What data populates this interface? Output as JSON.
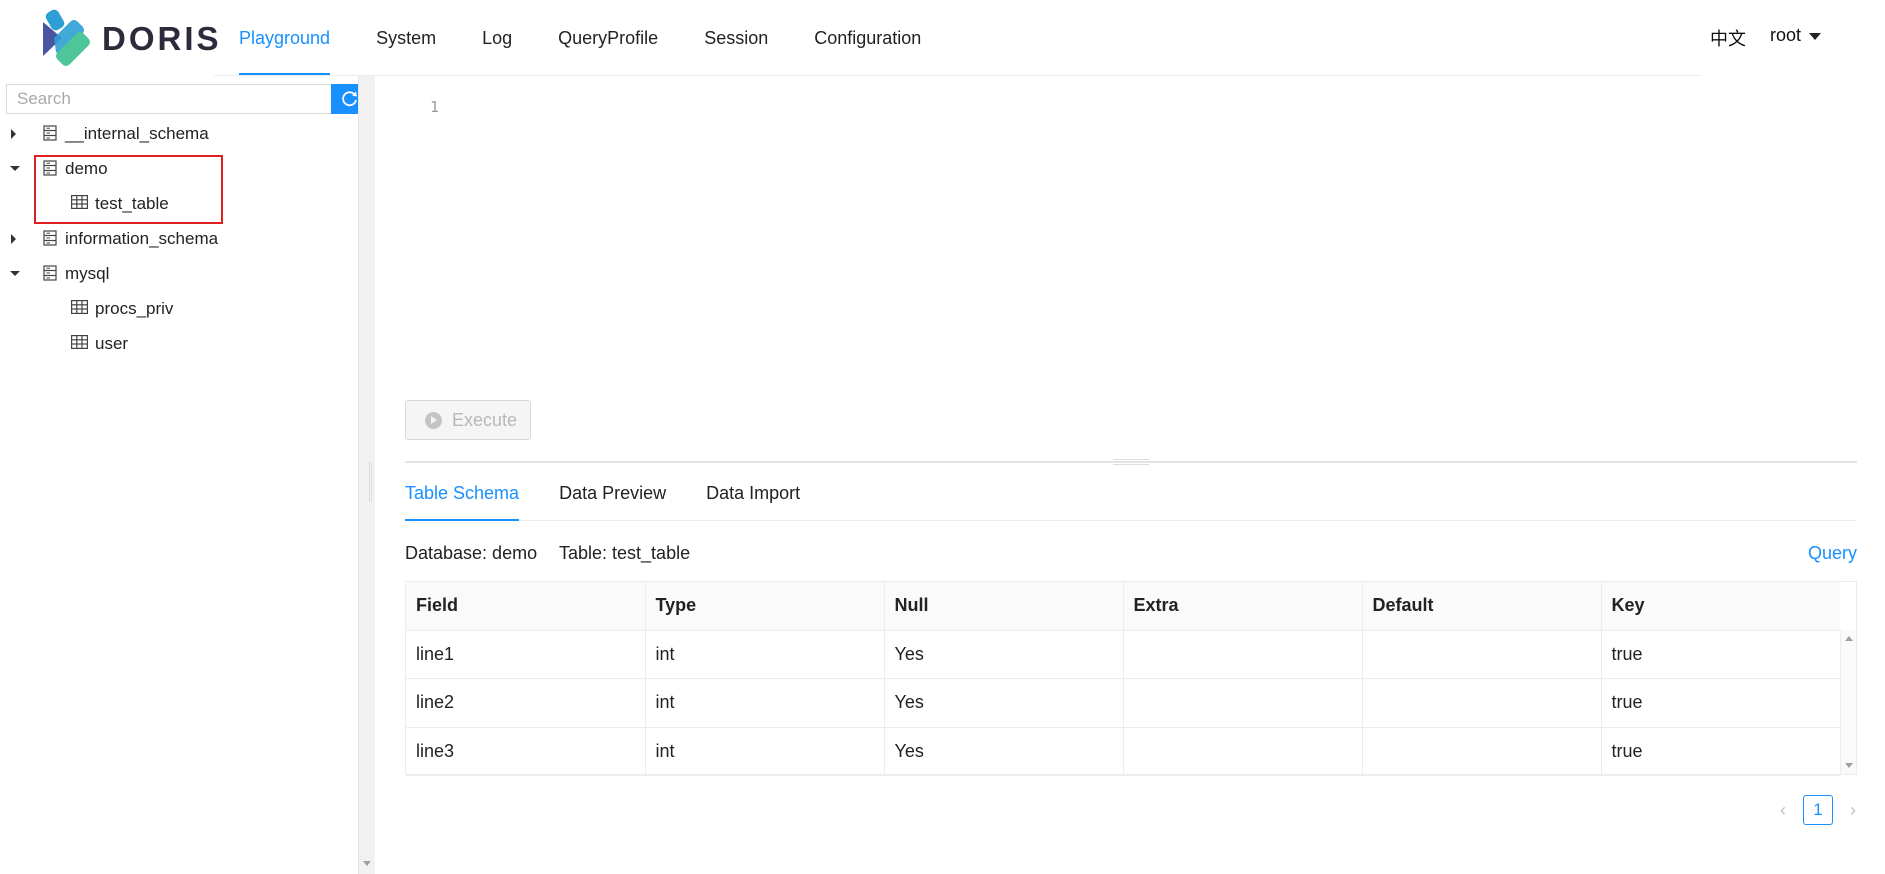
{
  "header": {
    "logo_text": "DORIS",
    "nav": [
      {
        "label": "Playground",
        "active": true
      },
      {
        "label": "System",
        "active": false
      },
      {
        "label": "Log",
        "active": false
      },
      {
        "label": "QueryProfile",
        "active": false
      },
      {
        "label": "Session",
        "active": false
      },
      {
        "label": "Configuration",
        "active": false
      }
    ],
    "language": "中文",
    "user": "root"
  },
  "sidebar": {
    "search_placeholder": "Search",
    "tree": [
      {
        "label": "__internal_schema",
        "type": "database",
        "expanded": false
      },
      {
        "label": "demo",
        "type": "database",
        "expanded": true,
        "children": [
          {
            "label": "test_table",
            "type": "table"
          }
        ]
      },
      {
        "label": "information_schema",
        "type": "database",
        "expanded": false
      },
      {
        "label": "mysql",
        "type": "database",
        "expanded": true,
        "children": [
          {
            "label": "procs_priv",
            "type": "table"
          },
          {
            "label": "user",
            "type": "table"
          }
        ]
      }
    ]
  },
  "editor": {
    "line_number": "1",
    "execute_label": "Execute"
  },
  "result": {
    "tabs": [
      {
        "label": "Table Schema",
        "active": true
      },
      {
        "label": "Data Preview",
        "active": false
      },
      {
        "label": "Data Import",
        "active": false
      }
    ],
    "database_label": "Database: demo",
    "table_label": "Table: test_table",
    "query_link": "Query",
    "columns": [
      "Field",
      "Type",
      "Null",
      "Extra",
      "Default",
      "Key"
    ],
    "rows": [
      [
        "line1",
        "int",
        "Yes",
        "",
        "",
        "true"
      ],
      [
        "line2",
        "int",
        "Yes",
        "",
        "",
        "true"
      ],
      [
        "line3",
        "int",
        "Yes",
        "",
        "",
        "true"
      ]
    ],
    "pagination": {
      "current_page": "1"
    }
  },
  "colors": {
    "accent": "#1890ff",
    "highlight_border": "#e02020",
    "logo_blue": "#2e9fd4",
    "logo_green": "#4fc69a",
    "logo_indigo": "#4a55a2"
  }
}
